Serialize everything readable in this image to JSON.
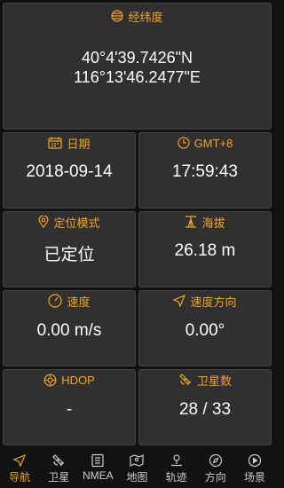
{
  "latlng": {
    "title": "经纬度",
    "lat": "40°4'39.7426\"N",
    "lng": "116°13'46.2477\"E"
  },
  "date": {
    "title": "日期",
    "value": "2018-09-14"
  },
  "time": {
    "title": "GMT+8",
    "value": "17:59:43"
  },
  "fix": {
    "title": "定位模式",
    "value": "已定位"
  },
  "altitude": {
    "title": "海拔",
    "value": "26.18 m"
  },
  "speed": {
    "title": "速度",
    "value": "0.00 m/s"
  },
  "bearing": {
    "title": "速度方向",
    "value": "0.00°"
  },
  "hdop": {
    "title": "HDOP",
    "value": "-"
  },
  "satellites": {
    "title": "卫星数",
    "value": "28 / 33"
  },
  "nav": {
    "items": [
      {
        "label": "导航",
        "icon": "navigation-arrow-icon",
        "active": true
      },
      {
        "label": "卫星",
        "icon": "satellite-icon"
      },
      {
        "label": "NMEA",
        "icon": "document-icon"
      },
      {
        "label": "地图",
        "icon": "map-icon"
      },
      {
        "label": "轨迹",
        "icon": "track-pin-icon"
      },
      {
        "label": "方向",
        "icon": "compass-icon"
      },
      {
        "label": "场景",
        "icon": "play-circle-icon"
      }
    ]
  },
  "colors": {
    "accent": "#f3a321",
    "card": "#303030",
    "background": "#111111"
  }
}
